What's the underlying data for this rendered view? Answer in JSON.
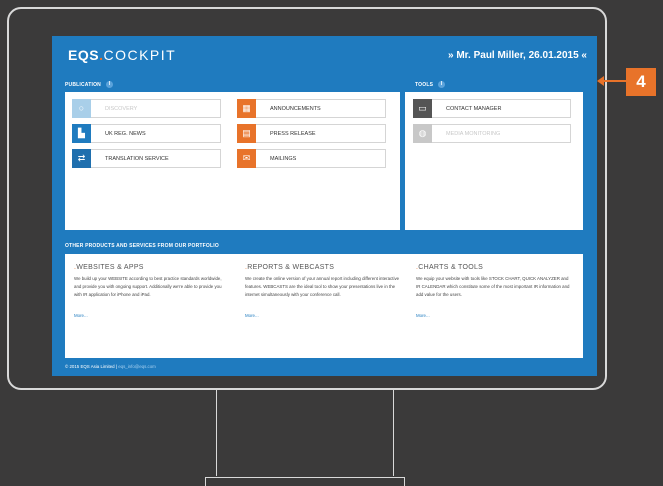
{
  "header": {
    "logo_main": "EQS",
    "logo_dot": ".",
    "logo_rest": "COCKPIT",
    "greeting": "» Mr. Paul Miller, 26.01.2015 «"
  },
  "publication": {
    "label": "PUBLICATION",
    "info": "i",
    "tiles": [
      {
        "label": "DISCOVERY",
        "icon": "circle-icon",
        "color": "#a9cfe9",
        "dim": true
      },
      {
        "label": "UK REG. NEWS",
        "icon": "city-icon",
        "color": "#1f7bbf",
        "dim": false
      },
      {
        "label": "TRANSLATION SERVICE",
        "icon": "swap-icon",
        "color": "#1f6fae",
        "dim": false
      },
      {
        "label": "ANNOUNCEMENTS",
        "icon": "building-icon",
        "color": "#e8732a",
        "dim": false
      },
      {
        "label": "PRESS RELEASE",
        "icon": "newspaper-icon",
        "color": "#e8732a",
        "dim": false
      },
      {
        "label": "MAILINGS",
        "icon": "mail-icon",
        "color": "#e8732a",
        "dim": false
      }
    ]
  },
  "tools": {
    "label": "TOOLS",
    "info": "i",
    "tiles": [
      {
        "label": "CONTACT MANAGER",
        "icon": "contact-card-icon",
        "color": "#555555",
        "dim": false
      },
      {
        "label": "MEDIA MONITORING",
        "icon": "globe-icon",
        "color": "#c8c8c8",
        "dim": true
      }
    ]
  },
  "portfolio": {
    "label": "OTHER PRODUCTS AND SERVICES FROM OUR PORTFOLIO",
    "columns": [
      {
        "title": "WEBSITES & APPS",
        "body": "We build up your WEBSITE according to best practice standards worldwide, and provide you with ongoing support. Additionally we're able to provide you with IR application for iPhone and iPad.",
        "more": "More..."
      },
      {
        "title": "REPORTS & WEBCASTS",
        "body": "We create the online version of your annual report including different interactive features. WEBCASTS are the ideal tool to show your presentations live in the internet simultaneously with your conference call.",
        "more": "More..."
      },
      {
        "title": "CHARTS & TOOLS",
        "body": "We equip your website with tools like STOCK CHART, QUICK ANALYZER and IR CALENDAR which constitute some of the most important IR information and add value for the users.",
        "more": "More..."
      }
    ]
  },
  "footer": {
    "copyright": "© 2015 EQS Asia Limited | ",
    "link": "eqs_info@eqs.com"
  },
  "callout": {
    "number": "4"
  }
}
